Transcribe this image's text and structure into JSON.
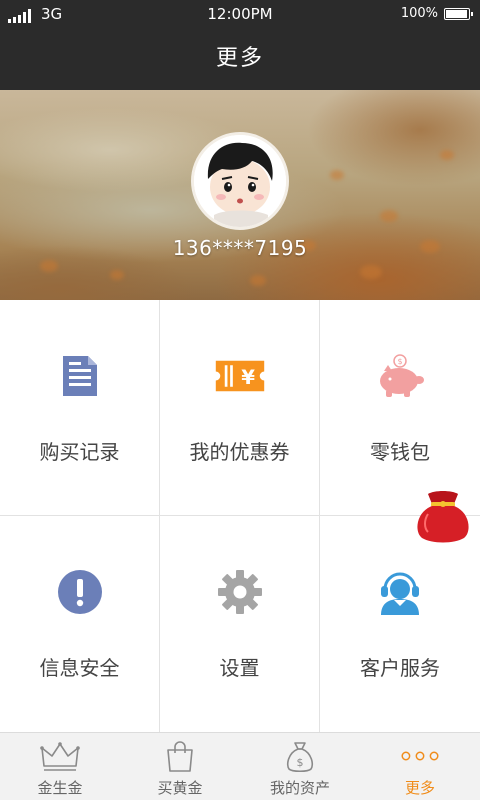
{
  "status_bar": {
    "network": "3G",
    "time": "12:00PM",
    "battery": "100%",
    "battery_level": 1.0
  },
  "header": {
    "title": "更多"
  },
  "profile": {
    "phone": "136****7195"
  },
  "menu": [
    {
      "label": "购买记录",
      "icon": "document-icon",
      "color": "#6b7fb8"
    },
    {
      "label": "我的优惠券",
      "icon": "coupon-icon",
      "color": "#f7931e"
    },
    {
      "label": "零钱包",
      "icon": "piggy-bank-icon",
      "color": "#f2a0a0"
    },
    {
      "label": "信息安全",
      "icon": "exclamation-icon",
      "color": "#6b7fb8"
    },
    {
      "label": "设置",
      "icon": "gear-icon",
      "color": "#999999"
    },
    {
      "label": "客户服务",
      "icon": "customer-service-icon",
      "color": "#3a9ad9"
    }
  ],
  "tabbar": {
    "active_color": "#f08c1a",
    "items": [
      {
        "label": "金生金",
        "icon": "crown-icon"
      },
      {
        "label": "买黄金",
        "icon": "shopping-bag-icon"
      },
      {
        "label": "我的资产",
        "icon": "money-bag-icon"
      },
      {
        "label": "更多",
        "icon": "more-dots-icon",
        "active": true
      }
    ]
  }
}
